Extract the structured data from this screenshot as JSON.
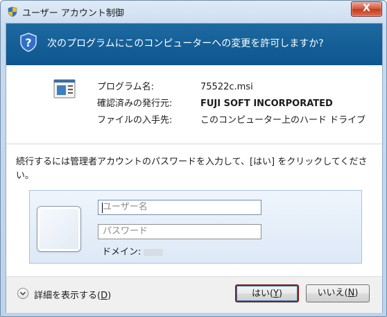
{
  "window": {
    "title": "ユーザー アカウント制御",
    "close_label": "X"
  },
  "banner": {
    "question": "次のプログラムにこのコンピューターへの変更を許可しますか?"
  },
  "program_info": {
    "labels": [
      "プログラム名:",
      "確認済みの発行元:",
      "ファイルの入手先:"
    ],
    "program_name": "75522c.msi",
    "publisher": "FUJI SOFT INCORPORATED",
    "origin": "このコンピューター上のハード ドライブ"
  },
  "instruction": "続行するには管理者アカウントのパスワードを入力して、[はい] をクリックしてください。",
  "credentials": {
    "username_placeholder": "ユーザー名",
    "password_placeholder": "パスワード",
    "domain_label": "ドメイン:"
  },
  "footer": {
    "details": {
      "text": "詳細を表示する(",
      "key": "D",
      "end": ")"
    },
    "yes": {
      "text": "はい(",
      "key": "Y",
      "end": ")"
    },
    "no": {
      "text": "いいえ(",
      "key": "N",
      "end": ")"
    }
  },
  "icons": {
    "title": "uac-shield-icon",
    "banner": "question-icon",
    "program": "program-icon",
    "details": "chevron-down-icon"
  }
}
